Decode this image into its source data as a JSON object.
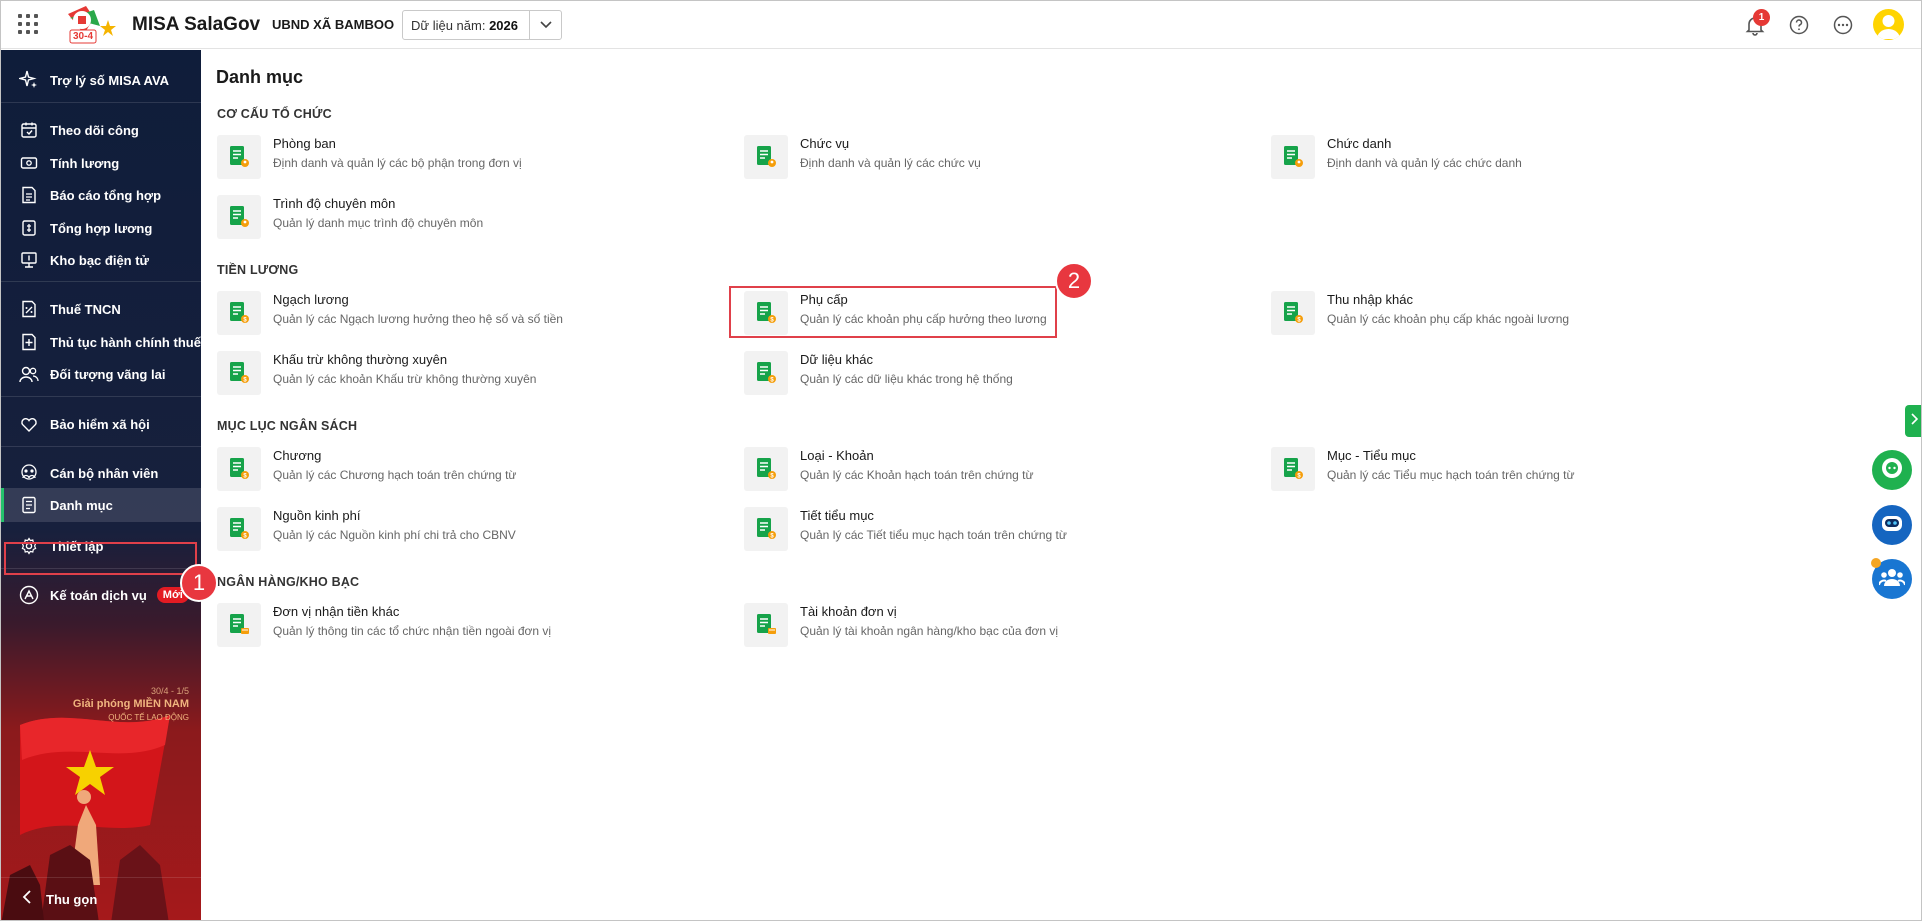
{
  "header": {
    "app_name": "MISA SalaGov",
    "org_name": "UBND XÃ BAMBOO",
    "year_label": "Dữ liệu năm:",
    "year_value": "2026",
    "notification_count": "1",
    "logo_text": "30-4"
  },
  "sidebar": {
    "items": [
      {
        "label": "Trợ lý số MISA AVA",
        "icon": "sparkle-icon"
      },
      {
        "label": "Theo dõi công",
        "icon": "calendar-icon"
      },
      {
        "label": "Tính lương",
        "icon": "money-icon"
      },
      {
        "label": "Báo cáo tổng hợp",
        "icon": "report-icon"
      },
      {
        "label": "Tổng hợp lương",
        "icon": "salary-summary-icon"
      },
      {
        "label": "Kho bạc điện tử",
        "icon": "treasury-icon"
      },
      {
        "label": "Thuế TNCN",
        "icon": "tax-icon"
      },
      {
        "label": "Thủ tục hành chính thuế",
        "icon": "tax-procedure-icon"
      },
      {
        "label": "Đối tượng vãng lai",
        "icon": "people-icon"
      },
      {
        "label": "Bảo hiểm xã hội",
        "icon": "insurance-icon"
      },
      {
        "label": "Cán bộ nhân viên",
        "icon": "staff-icon"
      },
      {
        "label": "Danh mục",
        "icon": "catalog-icon"
      },
      {
        "label": "Thiết lập",
        "icon": "gear-icon"
      },
      {
        "label": "Kế toán dịch vụ",
        "icon": "accounting-icon",
        "badge": "Mới"
      }
    ],
    "poster": {
      "line1": "30/4 - 1/5",
      "line2": "Giải phóng MIỀN NAM",
      "line3": "QUỐC TẾ LAO ĐỘNG"
    },
    "collapse_label": "Thu gọn"
  },
  "main": {
    "title": "Danh mục",
    "sections": [
      {
        "title": "CƠ CẤU TỔ CHỨC",
        "items": [
          {
            "title": "Phòng ban",
            "desc": "Định danh và quản lý các bộ phận trong đơn vị"
          },
          {
            "title": "Chức vụ",
            "desc": "Định danh và quản lý các chức vụ"
          },
          {
            "title": "Chức danh",
            "desc": "Định danh và quản lý các chức danh"
          },
          {
            "title": "Trình độ chuyên môn",
            "desc": "Quản lý danh mục trình độ chuyên môn"
          }
        ]
      },
      {
        "title": "TIỀN LƯƠNG",
        "items": [
          {
            "title": "Ngạch lương",
            "desc": "Quản lý các Ngạch lương hưởng theo hệ số và số tiền"
          },
          {
            "title": "Phụ cấp",
            "desc": "Quản lý các khoản phụ cấp hưởng theo lương"
          },
          {
            "title": "Thu nhập khác",
            "desc": "Quản lý các khoản phụ cấp khác ngoài lương"
          },
          {
            "title": "Khấu trừ không thường xuyên",
            "desc": "Quản lý các khoản Khấu trừ không thường xuyên"
          },
          {
            "title": "Dữ liệu khác",
            "desc": "Quản lý các dữ liệu khác trong hệ thống"
          }
        ]
      },
      {
        "title": "MỤC LỤC NGÂN SÁCH",
        "items": [
          {
            "title": "Chương",
            "desc": "Quản lý các Chương hạch toán trên chứng từ"
          },
          {
            "title": "Loại - Khoản",
            "desc": "Quản lý các Khoản hạch toán trên chứng từ"
          },
          {
            "title": "Mục - Tiểu mục",
            "desc": "Quản lý các Tiểu mục hạch toán trên chứng từ"
          },
          {
            "title": "Nguồn kinh phí",
            "desc": "Quản lý các Nguồn kinh phí chi trả cho CBNV"
          },
          {
            "title": "Tiết tiểu mục",
            "desc": "Quản lý các Tiết tiểu mục hạch toán trên chứng từ"
          }
        ]
      },
      {
        "title": "NGÂN HÀNG/KHO BẠC",
        "items": [
          {
            "title": "Đơn vị nhận tiền khác",
            "desc": "Quản lý thông tin các tổ chức nhận tiền ngoài đơn vị"
          },
          {
            "title": "Tài khoản đơn vị",
            "desc": "Quản lý tài khoản ngân hàng/kho bạc của đơn vị"
          }
        ]
      }
    ]
  },
  "annotations": {
    "step1": "1",
    "step2": "2"
  },
  "colors": {
    "accent_green": "#25c26c",
    "highlight_red": "#e0404a",
    "sidebar_bg": "#0f1d3a"
  }
}
